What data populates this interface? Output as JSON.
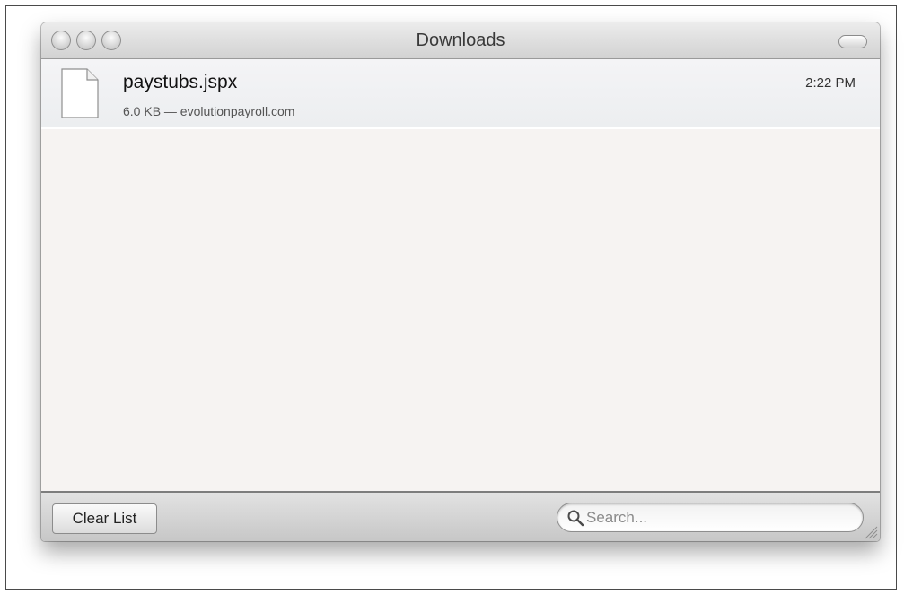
{
  "window": {
    "title": "Downloads"
  },
  "downloads": [
    {
      "file_name": "paystubs.jspx",
      "details": "6.0 KB — evolutionpayroll.com",
      "time": "2:22 PM",
      "icon": "document-icon"
    }
  ],
  "footer": {
    "clear_button_label": "Clear List",
    "search_placeholder": "Search..."
  },
  "icons": {
    "close": "close-icon",
    "minimize": "minimize-icon",
    "zoom": "zoom-icon",
    "toolbar_toggle": "toolbar-toggle-icon",
    "search": "search-icon",
    "resize": "resize-grip-icon"
  }
}
